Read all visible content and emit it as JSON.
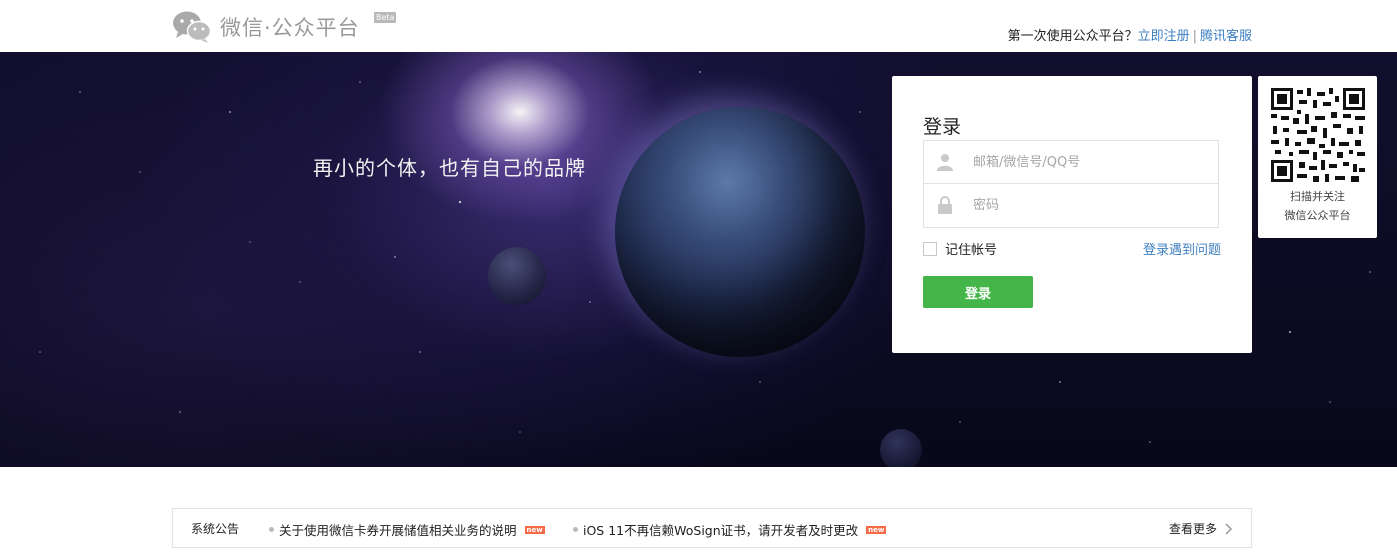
{
  "header": {
    "logo_text": "微信·公众平台",
    "beta_label": "Beta",
    "first_time_text": "第一次使用公众平台？",
    "register_link": "立即注册",
    "separator": "|",
    "service_link": "腾讯客服"
  },
  "banner": {
    "slogan": "再小的个体，也有自己的品牌"
  },
  "login": {
    "title": "登录",
    "account_placeholder": "邮箱/微信号/QQ号",
    "password_placeholder": "密码",
    "remember_label": "记住帐号",
    "problem_link": "登录遇到问题",
    "submit_label": "登录"
  },
  "qr": {
    "line1": "扫描并关注",
    "line2": "微信公众平台"
  },
  "notice": {
    "title": "系统公告",
    "items": [
      {
        "text": "关于使用微信卡券开展储值相关业务的说明",
        "badge": "new"
      },
      {
        "text": "iOS 11不再信赖WoSign证书，请开发者及时更改",
        "badge": "new"
      }
    ],
    "more_label": "查看更多"
  },
  "colors": {
    "accent_green": "#44b549",
    "link_blue": "#3d7fc1",
    "badge_red": "#f56b48"
  },
  "icons": [
    "wechat-logo-icon",
    "user-icon",
    "lock-icon",
    "qr-code-icon",
    "chevron-right-icon"
  ]
}
